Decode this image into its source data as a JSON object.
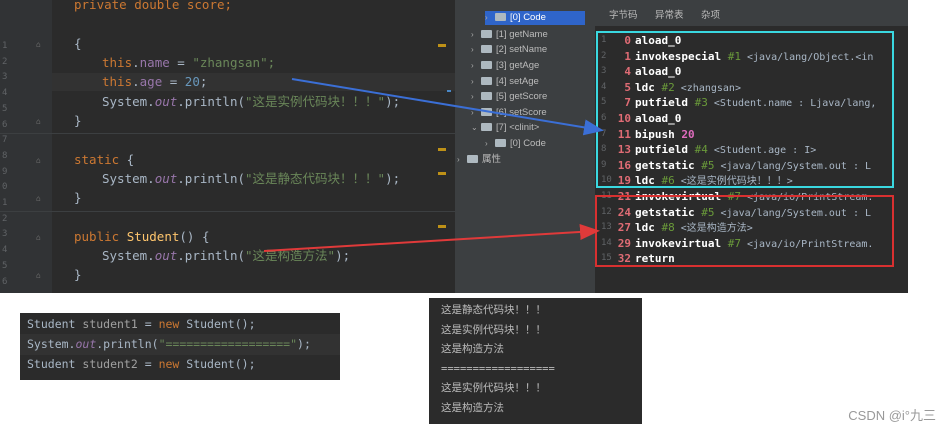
{
  "editor": {
    "line_numbers": [
      "1",
      "2",
      "3",
      "4",
      "5",
      "6",
      "7",
      "8",
      "9",
      "0",
      "1",
      "2",
      "3",
      "4",
      "5",
      "6"
    ],
    "lines": [
      {
        "indent": 0,
        "parts": [
          {
            "t": "private double score;",
            "c": "kw"
          }
        ]
      },
      {
        "indent": 0,
        "parts": [
          {
            "t": "{",
            "c": ""
          }
        ]
      },
      {
        "indent": 1,
        "parts": [
          {
            "t": "this",
            "c": "kw"
          },
          {
            "t": ".",
            "c": ""
          },
          {
            "t": "name",
            "c": "fld"
          },
          {
            "t": " = ",
            "c": ""
          },
          {
            "t": "\"",
            "c": "str"
          },
          {
            "t": "zhangsan",
            "c": "str"
          },
          {
            "t": "\";",
            "c": "str"
          }
        ]
      },
      {
        "indent": 1,
        "parts": [
          {
            "t": "this",
            "c": "kw"
          },
          {
            "t": ".",
            "c": ""
          },
          {
            "t": "age",
            "c": "fld"
          },
          {
            "t": " = ",
            "c": ""
          },
          {
            "t": "20",
            "c": "num"
          },
          {
            "t": ";",
            "c": ""
          }
        ]
      },
      {
        "indent": 1,
        "parts": [
          {
            "t": "System.",
            "c": ""
          },
          {
            "t": "out",
            "c": "ital"
          },
          {
            "t": ".println(",
            "c": ""
          },
          {
            "t": "\"这是实例代码块！！！\"",
            "c": "str"
          },
          {
            "t": ");",
            "c": ""
          }
        ]
      },
      {
        "indent": 0,
        "parts": [
          {
            "t": "}",
            "c": ""
          }
        ]
      },
      {
        "indent": 0,
        "parts": [
          {
            "t": "static",
            "c": "kw"
          },
          {
            "t": " {",
            "c": ""
          }
        ]
      },
      {
        "indent": 1,
        "parts": [
          {
            "t": "System.",
            "c": ""
          },
          {
            "t": "out",
            "c": "ital"
          },
          {
            "t": ".println(",
            "c": ""
          },
          {
            "t": "\"这是静态代码块！！！\"",
            "c": "str"
          },
          {
            "t": ");",
            "c": ""
          }
        ]
      },
      {
        "indent": 0,
        "parts": [
          {
            "t": "}",
            "c": ""
          }
        ]
      },
      {
        "indent": 0,
        "parts": [
          {
            "t": "public",
            "c": "kw"
          },
          {
            "t": " ",
            "c": ""
          },
          {
            "t": "Student",
            "c": "fn"
          },
          {
            "t": "() {",
            "c": ""
          }
        ]
      },
      {
        "indent": 1,
        "parts": [
          {
            "t": "System.",
            "c": ""
          },
          {
            "t": "out",
            "c": "ital"
          },
          {
            "t": ".println(",
            "c": ""
          },
          {
            "t": "\"这是构造方法\"",
            "c": "str"
          },
          {
            "t": ");",
            "c": ""
          }
        ]
      },
      {
        "indent": 0,
        "parts": [
          {
            "t": "}",
            "c": ""
          }
        ]
      }
    ]
  },
  "tree": {
    "items": [
      {
        "label": "[0] Code",
        "level": 2,
        "arrow": "›",
        "selected": true
      },
      {
        "label": "[1] getName",
        "level": 1,
        "arrow": "›",
        "selected": false
      },
      {
        "label": "[2] setName",
        "level": 1,
        "arrow": "›",
        "selected": false
      },
      {
        "label": "[3] getAge",
        "level": 1,
        "arrow": "›",
        "selected": false
      },
      {
        "label": "[4] setAge",
        "level": 1,
        "arrow": "›",
        "selected": false
      },
      {
        "label": "[5] getScore",
        "level": 1,
        "arrow": "›",
        "selected": false
      },
      {
        "label": "[6] setScore",
        "level": 1,
        "arrow": "›",
        "selected": false
      },
      {
        "label": "[7] <clinit>",
        "level": 1,
        "arrow": "⌄",
        "selected": false
      },
      {
        "label": "[0] Code",
        "level": 2,
        "arrow": "›",
        "selected": false
      },
      {
        "label": "属性",
        "level": 0,
        "arrow": "›",
        "selected": false
      }
    ]
  },
  "bytecode": {
    "tabs": [
      "字节码",
      "异常表",
      "杂项"
    ],
    "lines": [
      {
        "idx": "1",
        "off": "0",
        "op": "aload_0",
        "ref": "",
        "arg": ""
      },
      {
        "idx": "2",
        "off": "1",
        "op": "invokespecial",
        "ref": "#1",
        "arg": " <java/lang/Object.<in"
      },
      {
        "idx": "3",
        "off": "4",
        "op": "aload_0",
        "ref": "",
        "arg": ""
      },
      {
        "idx": "4",
        "off": "5",
        "op": "ldc",
        "ref": "#2",
        "arg": " <zhangsan>"
      },
      {
        "idx": "5",
        "off": "7",
        "op": "putfield",
        "ref": "#3",
        "arg": " <Student.name : Ljava/lang,"
      },
      {
        "idx": "6",
        "off": "10",
        "op": "aload_0",
        "ref": "",
        "arg": ""
      },
      {
        "idx": "7",
        "off": "11",
        "op": "bipush",
        "ref": "",
        "arg": "",
        "num": "20"
      },
      {
        "idx": "8",
        "off": "13",
        "op": "putfield",
        "ref": "#4",
        "arg": " <Student.age : I>"
      },
      {
        "idx": "9",
        "off": "16",
        "op": "getstatic",
        "ref": "#5",
        "arg": " <java/lang/System.out : L"
      },
      {
        "idx": "10",
        "off": "19",
        "op": "ldc",
        "ref": "#6",
        "arg": " <这是实例代码块！！！>"
      },
      {
        "idx": "11",
        "off": "21",
        "op": "invokevirtual",
        "ref": "#7",
        "arg": " <java/io/PrintStream."
      },
      {
        "idx": "12",
        "off": "24",
        "op": "getstatic",
        "ref": "#5",
        "arg": " <java/lang/System.out : L"
      },
      {
        "idx": "13",
        "off": "27",
        "op": "ldc",
        "ref": "#8",
        "arg": " <这是构造方法>"
      },
      {
        "idx": "14",
        "off": "29",
        "op": "invokevirtual",
        "ref": "#7",
        "arg": " <java/io/PrintStream."
      },
      {
        "idx": "15",
        "off": "32",
        "op": "return",
        "ref": "",
        "arg": ""
      }
    ]
  },
  "snippet": {
    "lines": [
      [
        {
          "t": "Student ",
          "c": ""
        },
        {
          "t": "student1",
          "c": "fld-gray"
        },
        {
          "t": " = ",
          "c": ""
        },
        {
          "t": "new",
          "c": "kw"
        },
        {
          "t": " Student();",
          "c": ""
        }
      ],
      [
        {
          "t": "System.",
          "c": ""
        },
        {
          "t": "out",
          "c": "ital"
        },
        {
          "t": ".println(",
          "c": ""
        },
        {
          "t": "\"==================\"",
          "c": "str"
        },
        {
          "t": ");",
          "c": ""
        }
      ],
      [
        {
          "t": "Student ",
          "c": ""
        },
        {
          "t": "student2",
          "c": "fld-gray"
        },
        {
          "t": " = ",
          "c": ""
        },
        {
          "t": "new",
          "c": "kw"
        },
        {
          "t": " Student();",
          "c": ""
        }
      ]
    ]
  },
  "console": {
    "lines": [
      "这是静态代码块！！！",
      "这是实例代码块！！！",
      "这是构造方法",
      "==================",
      "这是实例代码块！！！",
      "这是构造方法"
    ]
  },
  "watermark": "CSDN @i°九三",
  "colors": {
    "arrow_blue": "#3b6fd6",
    "arrow_red": "#e03a3a",
    "box_cyan": "#3ad8e0",
    "box_red": "#d93030"
  }
}
